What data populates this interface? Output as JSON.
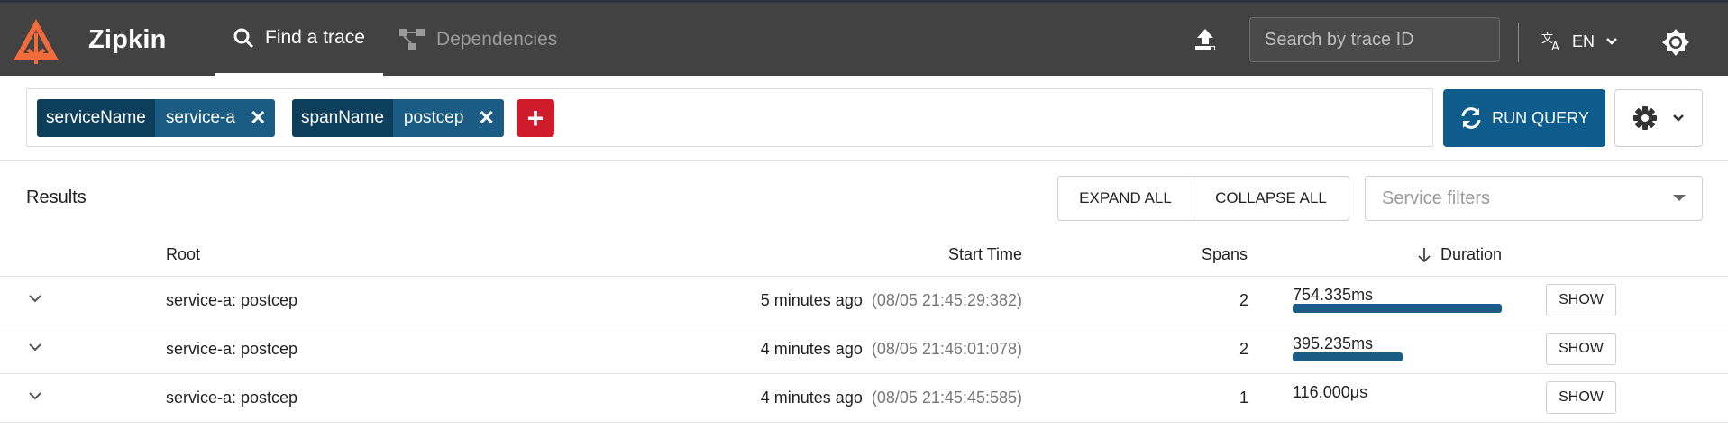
{
  "header": {
    "app_title": "Zipkin",
    "tabs": [
      {
        "label": "Find a trace",
        "icon": "search-icon",
        "active": true
      },
      {
        "label": "Dependencies",
        "icon": "dependency-graph-icon",
        "active": false
      }
    ],
    "trace_search_placeholder": "Search by trace ID",
    "language": "EN",
    "colors": {
      "bar_bg": "#424242",
      "logo": "#ff6b35"
    }
  },
  "query": {
    "criteria": [
      {
        "key": "serviceName",
        "value": "service-a"
      },
      {
        "key": "spanName",
        "value": "postcep"
      }
    ],
    "add_label": "+",
    "run_label": "RUN QUERY"
  },
  "results": {
    "label": "Results",
    "expand_all": "EXPAND ALL",
    "collapse_all": "COLLAPSE ALL",
    "service_filter_placeholder": "Service filters",
    "columns": {
      "root": "Root",
      "start_time": "Start Time",
      "spans": "Spans",
      "duration": "Duration",
      "sort_icon": "arrow-down-icon"
    },
    "rows": [
      {
        "root": "service-a: postcep",
        "relative": "5 minutes ago",
        "absolute": "(08/05 21:45:29:382)",
        "spans": "2",
        "duration": "754.335ms",
        "duration_fraction": 1.0,
        "show": "SHOW"
      },
      {
        "root": "service-a: postcep",
        "relative": "4 minutes ago",
        "absolute": "(08/05 21:46:01:078)",
        "spans": "2",
        "duration": "395.235ms",
        "duration_fraction": 0.524,
        "show": "SHOW"
      },
      {
        "root": "service-a: postcep",
        "relative": "4 minutes ago",
        "absolute": "(08/05 21:45:45:585)",
        "spans": "1",
        "duration": "116.000μs",
        "duration_fraction": 0.0,
        "show": "SHOW"
      }
    ],
    "bar_color": "#1a5c84"
  }
}
